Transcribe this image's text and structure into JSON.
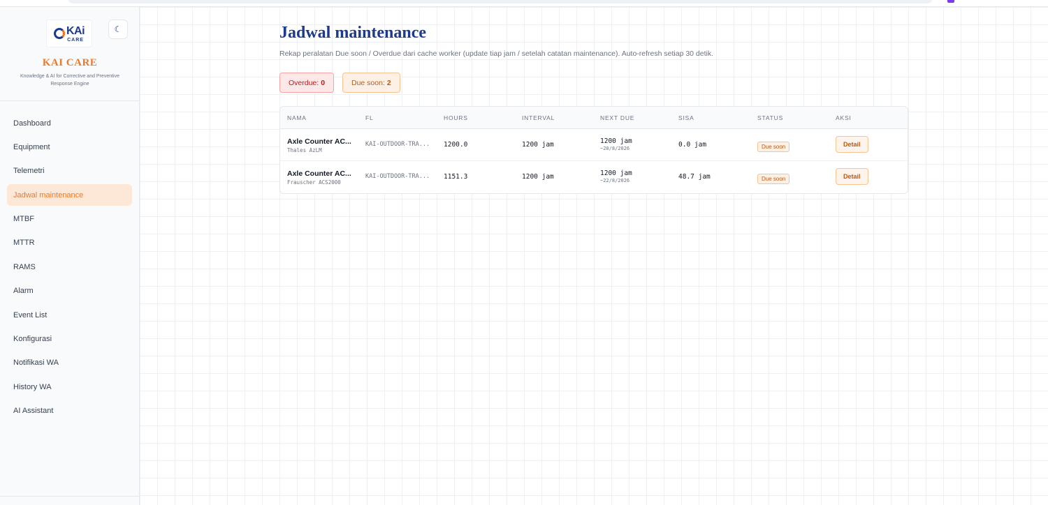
{
  "brand": {
    "logo_text": "KAi",
    "logo_sub": "CARE",
    "name": "KAI CARE",
    "tagline": "Knowledge & AI for Corrective and Preventive Response Engine",
    "theme_icon": "moon-icon"
  },
  "sidebar": {
    "items": [
      {
        "label": "Dashboard"
      },
      {
        "label": "Equipment"
      },
      {
        "label": "Telemetri"
      },
      {
        "label": "Jadwal maintenance",
        "active": true
      },
      {
        "label": "MTBF"
      },
      {
        "label": "MTTR"
      },
      {
        "label": "RAMS"
      },
      {
        "label": "Alarm"
      },
      {
        "label": "Event List"
      },
      {
        "label": "Konfigurasi"
      },
      {
        "label": "Notifikasi WA"
      },
      {
        "label": "History WA"
      },
      {
        "label": "AI Assistant"
      }
    ]
  },
  "page": {
    "title": "Jadwal maintenance",
    "subtitle": "Rekap peralatan Due soon / Overdue dari cache worker (update tiap jam / setelah catatan maintenance). Auto-refresh setiap 30 detik."
  },
  "summary": {
    "overdue_label": "Overdue:",
    "overdue_count": "0",
    "due_label": "Due soon:",
    "due_count": "2"
  },
  "table": {
    "headers": [
      "NAMA",
      "FL",
      "HOURS",
      "INTERVAL",
      "NEXT DUE",
      "SISA",
      "STATUS",
      "AKSI"
    ],
    "rows": [
      {
        "name": "Axle Counter AC...",
        "vendor": "Thales AzLM",
        "fl": "KAI-OUTDOOR-TRA...",
        "hours": "1200.0",
        "interval": "1200 jam",
        "next_due": "1200 jam",
        "next_due_date": "~20/8/2026",
        "sisa": "0.0 jam",
        "status": "Due soon",
        "action": "Detail"
      },
      {
        "name": "Axle Counter AC...",
        "vendor": "Frauscher ACS2000",
        "fl": "KAI-OUTDOOR-TRA...",
        "hours": "1151.3",
        "interval": "1200 jam",
        "next_due": "1200 jam",
        "next_due_date": "~22/8/2026",
        "sisa": "48.7 jam",
        "status": "Due soon",
        "action": "Detail"
      }
    ]
  }
}
